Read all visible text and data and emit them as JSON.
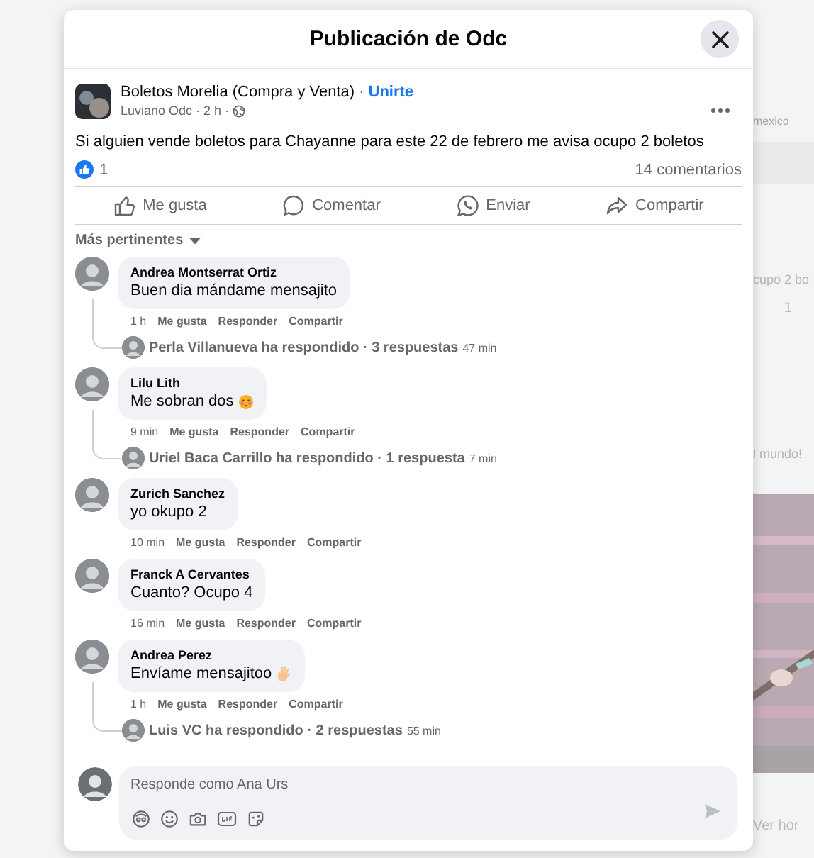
{
  "background": {
    "texts": [
      {
        "kind": "faint",
        "text": "mexico"
      },
      {
        "kind": "line",
        "text": "cupo 2 bo"
      },
      {
        "kind": "count",
        "text": "1"
      },
      {
        "kind": "line",
        "text": "l mundo!"
      },
      {
        "kind": "button",
        "text": "Ver hor"
      }
    ]
  },
  "dialog": {
    "title": "Publicación de Odc"
  },
  "post": {
    "group": "Boletos Morelia (Compra y Venta)",
    "join_separator": "·",
    "join": "Unirte",
    "byline": "Luviano Odc · 2 h ·",
    "text": "Si alguien vende boletos para Chayanne para este 22 de febrero me avisa ocupo 2 boletos",
    "likes": "1",
    "comments_count": "14 comentarios",
    "actions": [
      {
        "kind": "like",
        "label": "Me gusta"
      },
      {
        "kind": "comment",
        "label": "Comentar"
      },
      {
        "kind": "send",
        "label": "Enviar"
      },
      {
        "kind": "share",
        "label": "Compartir"
      }
    ]
  },
  "sort": "Más pertinentes",
  "comments": [
    {
      "name": "Andrea Montserrat Ortiz",
      "text": "Buen dia mándame mensajito",
      "time": "1 h",
      "actions": [
        "Me gusta",
        "Responder",
        "Compartir"
      ],
      "replies": {
        "summary": "Perla Villanueva ha respondido · 3 respuestas",
        "time": "47 min"
      }
    },
    {
      "name": "Lilu Lith",
      "text": "Me sobran dos",
      "kind": "blush",
      "time": "9 min",
      "actions": [
        "Me gusta",
        "Responder",
        "Compartir"
      ],
      "replies": {
        "summary": "Uriel Baca Carrillo ha respondido · 1 respuesta",
        "time": "7 min"
      }
    },
    {
      "name": "Zurich Sanchez",
      "text": "yo okupo 2",
      "time": "10 min",
      "actions": [
        "Me gusta",
        "Responder",
        "Compartir"
      ]
    },
    {
      "name": "Franck A Cervantes",
      "text": "Cuanto? Ocupo 4",
      "time": "16 min",
      "actions": [
        "Me gusta",
        "Responder",
        "Compartir"
      ]
    },
    {
      "name": "Andrea Perez",
      "text": "Envíame mensajitoo",
      "kind": "hand",
      "time": "1 h",
      "actions": [
        "Me gusta",
        "Responder",
        "Compartir"
      ],
      "replies": {
        "summary": "Luis VC ha respondido · 2 respuestas",
        "time": "55 min"
      }
    }
  ],
  "composer": {
    "placeholder": "Responde como Ana Urs"
  }
}
